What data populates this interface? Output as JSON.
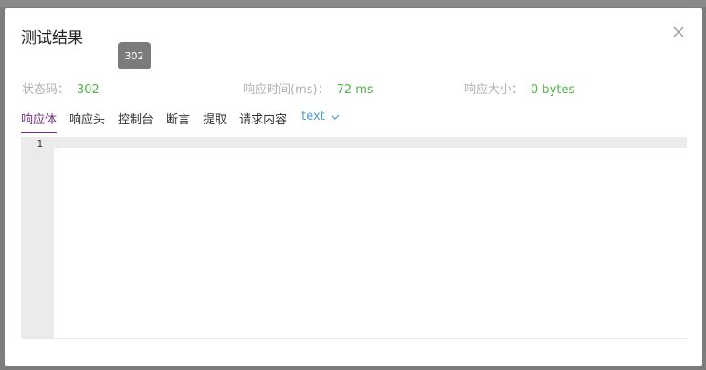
{
  "modal": {
    "title": "测试结果",
    "tooltip": "302"
  },
  "stats": {
    "status_label": "状态码：",
    "status_value": "302",
    "time_label": "响应时间(ms)：",
    "time_value": "72 ms",
    "size_label": "响应大小：",
    "size_value": "0 bytes"
  },
  "tabs": [
    {
      "label": "响应体"
    },
    {
      "label": "响应头"
    },
    {
      "label": "控制台"
    },
    {
      "label": "断言"
    },
    {
      "label": "提取"
    },
    {
      "label": "请求内容"
    }
  ],
  "format_select": {
    "value": "text"
  },
  "editor": {
    "line_number": "1"
  },
  "colors": {
    "accent": "#6c2f7b",
    "success": "#52b34a",
    "link": "#4a9bd8"
  },
  "icons": {
    "close": "close-icon",
    "dropdown": "chevron-down-icon"
  }
}
